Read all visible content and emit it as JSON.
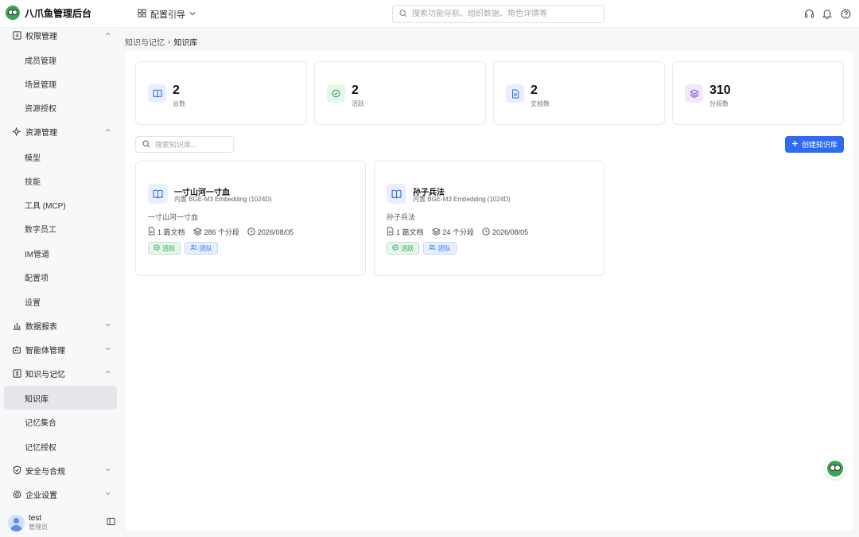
{
  "app": {
    "title": "八爪鱼管理后台"
  },
  "header": {
    "guide_label": "配置引导",
    "search_placeholder": "搜索功能导航、组织数据、角色详情等"
  },
  "sidebar": {
    "groups": [
      {
        "label": "权限管理",
        "icon": "shield-key-icon",
        "expanded": true
      },
      {
        "label": "资源管理",
        "icon": "sparkle-icon",
        "expanded": true
      },
      {
        "label": "数据报表",
        "icon": "bar-chart-icon",
        "expanded": false
      },
      {
        "label": "智能体管理",
        "icon": "robot-icon",
        "expanded": false
      },
      {
        "label": "知识与记忆",
        "icon": "brain-icon",
        "expanded": true
      },
      {
        "label": "安全与合规",
        "icon": "shield-check-icon",
        "expanded": false
      },
      {
        "label": "企业设置",
        "icon": "gear-icon",
        "expanded": false
      }
    ],
    "items": [
      {
        "label": "成员管理"
      },
      {
        "label": "场景管理"
      },
      {
        "label": "资源授权"
      },
      {
        "label": "模型"
      },
      {
        "label": "技能"
      },
      {
        "label": "工具 (MCP)"
      },
      {
        "label": "数字员工"
      },
      {
        "label": "IM管道"
      },
      {
        "label": "配置项"
      },
      {
        "label": "设置"
      },
      {
        "label": "知识库",
        "active": true
      },
      {
        "label": "记忆集合"
      },
      {
        "label": "记忆授权"
      }
    ],
    "user": {
      "name": "test",
      "role": "管理员"
    }
  },
  "breadcrumb": {
    "parent": "知识与记忆",
    "sep": "›",
    "current": "知识库"
  },
  "stats": [
    {
      "value": "2",
      "label": "总数",
      "icon": "book-icon",
      "color": "#e9effd"
    },
    {
      "value": "2",
      "label": "活跃",
      "icon": "check-circle-icon",
      "color": "#e6f6ec"
    },
    {
      "value": "2",
      "label": "文档数",
      "icon": "document-icon",
      "color": "#e9effd"
    },
    {
      "value": "310",
      "label": "分段数",
      "icon": "layers-icon",
      "color": "#f1e9fb"
    }
  ],
  "toolbar": {
    "search_placeholder": "搜索知识库...",
    "create_label": "创建知识库"
  },
  "cards": [
    {
      "title": "一寸山河一寸血",
      "model": "内置 BGE-M3 Embedding (1024D)",
      "desc": "一寸山河一寸血",
      "docs": "1 篇文档",
      "segments": "286 个分段",
      "date": "2026/08/05",
      "status": "活跃",
      "scope": "团队"
    },
    {
      "title": "孙子兵法",
      "model": "内置 BGE-M3 Embedding (1024D)",
      "desc": "孙子兵法",
      "docs": "1 篇文档",
      "segments": "24 个分段",
      "date": "2026/08/05",
      "status": "活跃",
      "scope": "团队"
    }
  ],
  "colors": {
    "accent": "#2f6bf0",
    "success": "#2a9d55",
    "brand": "#3aa655"
  }
}
